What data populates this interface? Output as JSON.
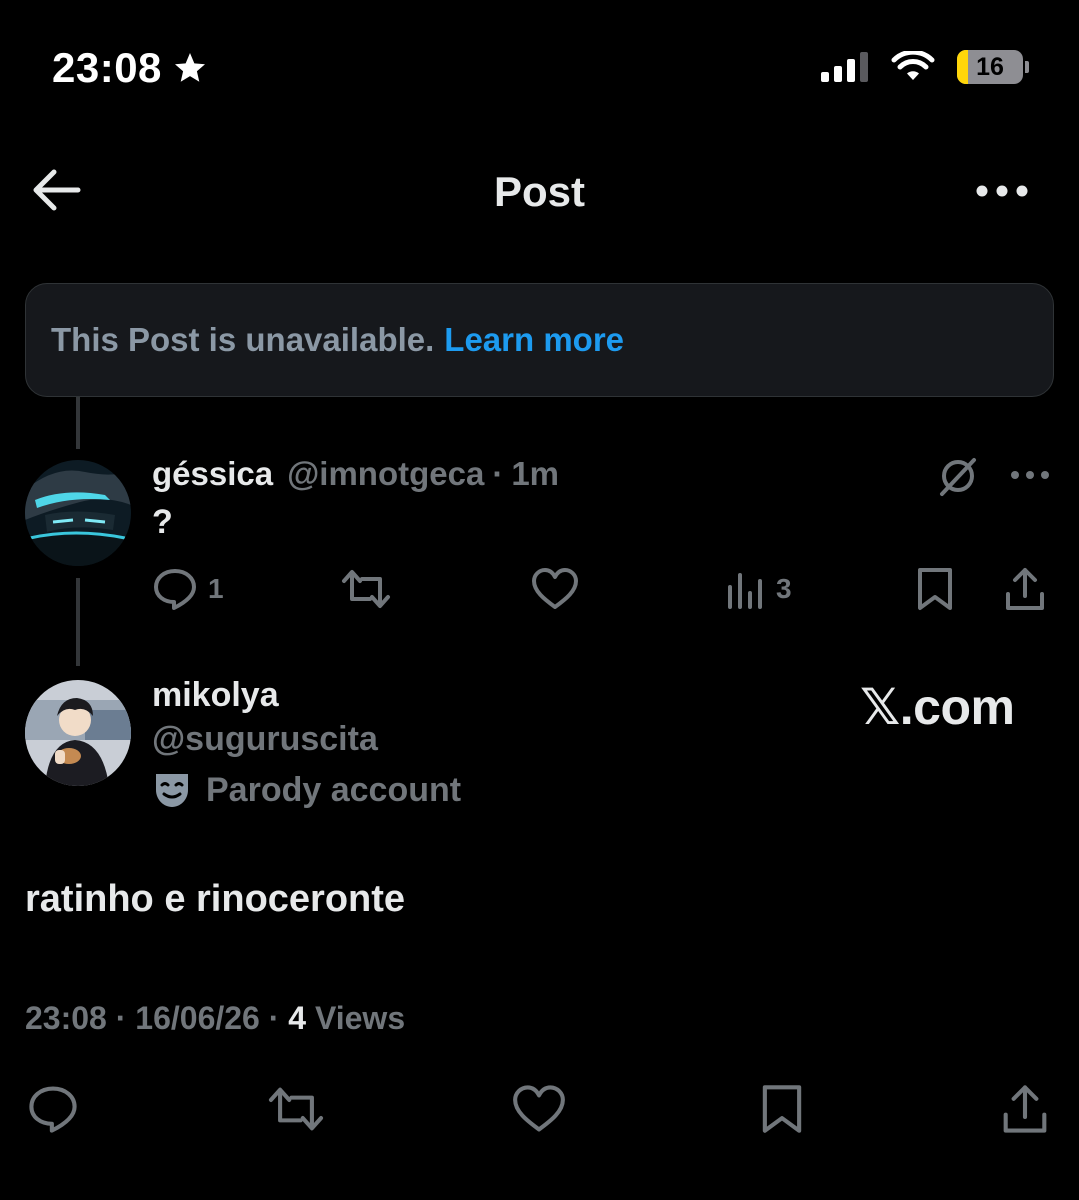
{
  "status_bar": {
    "time": "23:08",
    "battery_level": "16",
    "star_icon": "star-icon",
    "signal_icon": "cellular-signal-icon",
    "wifi_icon": "wifi-icon"
  },
  "header": {
    "title": "Post",
    "back_icon": "back-arrow-icon",
    "more_icon": "more-options-icon"
  },
  "unavailable_notice": {
    "text": "This Post is unavailable.",
    "link": "Learn more"
  },
  "reply": {
    "display_name": "géssica",
    "handle": "@imnotgeca",
    "separator": "·",
    "time": "1m",
    "text": "?",
    "actions": {
      "reply_count": "1",
      "retweet_count": "",
      "like_count": "",
      "views_count": "3"
    }
  },
  "main_post": {
    "display_name": "mikolya",
    "handle": "@suguruscita",
    "badge": "Parody account",
    "text": "ratinho e rinoceronte",
    "time": "23:08",
    "date": "16/06/26",
    "separator": "·",
    "views_count": "4",
    "views_label": "Views"
  },
  "watermark": "𝕏.com",
  "colors": {
    "background": "#000000",
    "link": "#1d9bf0",
    "muted": "#71767b",
    "text": "#e7e9ea",
    "battery_fill": "#ffd60a"
  }
}
